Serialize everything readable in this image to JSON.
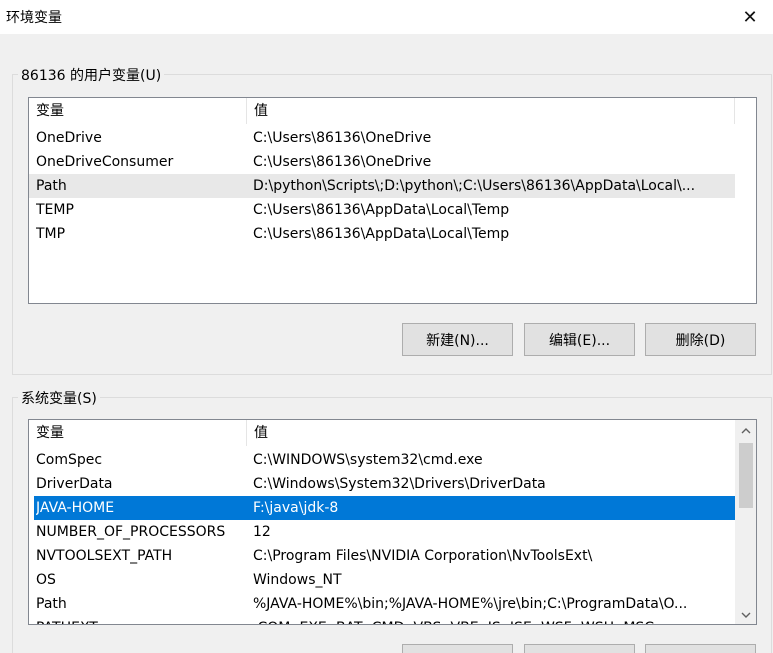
{
  "window": {
    "title": "环境变量",
    "close_glyph": "✕"
  },
  "user_vars": {
    "group_label": "86136 的用户变量(U)",
    "col_name": "变量",
    "col_value": "值",
    "rows": [
      {
        "name": "OneDrive",
        "value": "C:\\Users\\86136\\OneDrive"
      },
      {
        "name": "OneDriveConsumer",
        "value": "C:\\Users\\86136\\OneDrive"
      },
      {
        "name": "Path",
        "value": "D:\\python\\Scripts\\;D:\\python\\;C:\\Users\\86136\\AppData\\Local\\..."
      },
      {
        "name": "TEMP",
        "value": "C:\\Users\\86136\\AppData\\Local\\Temp"
      },
      {
        "name": "TMP",
        "value": "C:\\Users\\86136\\AppData\\Local\\Temp"
      }
    ],
    "buttons": {
      "new": "新建(N)...",
      "edit": "编辑(E)...",
      "delete": "删除(D)"
    }
  },
  "system_vars": {
    "group_label": "系统变量(S)",
    "col_name": "变量",
    "col_value": "值",
    "rows": [
      {
        "name": "ComSpec",
        "value": "C:\\WINDOWS\\system32\\cmd.exe"
      },
      {
        "name": "DriverData",
        "value": "C:\\Windows\\System32\\Drivers\\DriverData"
      },
      {
        "name": "JAVA-HOME",
        "value": "F:\\java\\jdk-8"
      },
      {
        "name": "NUMBER_OF_PROCESSORS",
        "value": "12"
      },
      {
        "name": "NVTOOLSEXT_PATH",
        "value": "C:\\Program Files\\NVIDIA Corporation\\NvToolsExt\\"
      },
      {
        "name": "OS",
        "value": "Windows_NT"
      },
      {
        "name": "Path",
        "value": "%JAVA-HOME%\\bin;%JAVA-HOME%\\jre\\bin;C:\\ProgramData\\O..."
      },
      {
        "name": "PATHEXT",
        "value": ".COM;.EXE;.BAT;.CMD;.VBS;.VBE;.JS;.JSE;.WSF;.WSH;.MSC"
      }
    ],
    "selected": "JAVA-HOME"
  },
  "icons": {
    "scroll_up": "chevron-up-icon",
    "scroll_down": "chevron-down-icon",
    "close": "close-icon"
  }
}
